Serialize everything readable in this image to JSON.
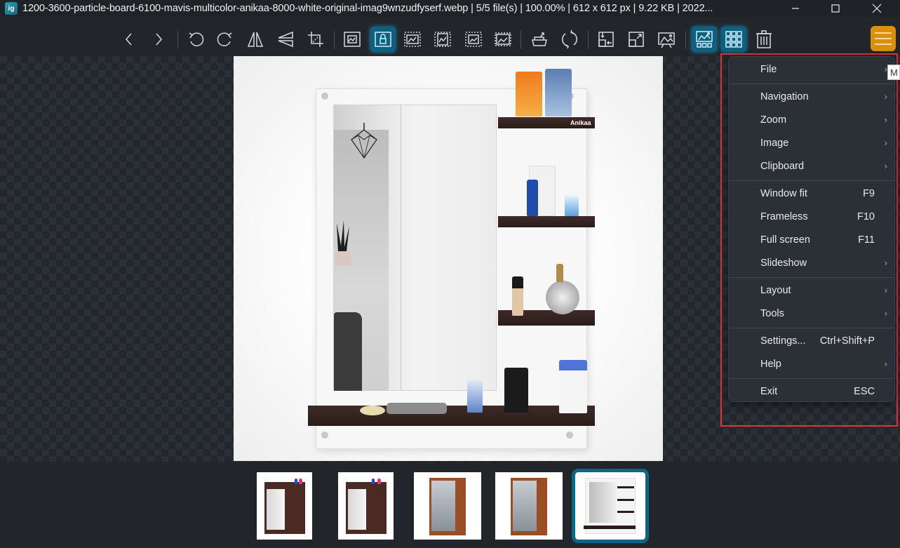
{
  "window": {
    "app_icon": "imageglass-icon",
    "title": "1200-3600-particle-board-6100-mavis-multicolor-anikaa-8000-white-original-imag9wnzudfyserf.webp  |  5/5 file(s)  |  100.00%  |  612 x 612 px  |  9.22 KB  |  2022...",
    "file_name": "1200-3600-particle-board-6100-mavis-multicolor-anikaa-8000-white-original-imag9wnzudfyserf.webp",
    "file_index": "5/5 file(s)",
    "zoom": "100.00%",
    "dimensions": "612 x 612 px",
    "file_size": "9.22 KB",
    "date": "2022...",
    "controls": {
      "minimize": "minimize-icon",
      "maximize": "maximize-icon",
      "close": "close-icon"
    }
  },
  "toolbar": {
    "buttons": [
      {
        "id": "previous",
        "icon": "chevron-left-icon",
        "active": false
      },
      {
        "id": "next",
        "icon": "chevron-right-icon",
        "active": false
      },
      {
        "id": "rotate-left",
        "icon": "rotate-left-icon",
        "active": false
      },
      {
        "id": "rotate-right",
        "icon": "rotate-right-icon",
        "active": false
      },
      {
        "id": "flip-horizontal",
        "icon": "flip-horizontal-icon",
        "active": false
      },
      {
        "id": "flip-vertical",
        "icon": "flip-vertical-icon",
        "active": false
      },
      {
        "id": "crop",
        "icon": "crop-icon",
        "active": false
      },
      {
        "id": "auto-zoom",
        "icon": "auto-zoom-icon",
        "active": false
      },
      {
        "id": "lock-zoom",
        "icon": "lock-zoom-icon",
        "active": true
      },
      {
        "id": "scale-to-width",
        "icon": "scale-to-width-icon",
        "active": false
      },
      {
        "id": "scale-to-height",
        "icon": "scale-to-height-icon",
        "active": false
      },
      {
        "id": "scale-to-fit",
        "icon": "scale-to-fit-icon",
        "active": false
      },
      {
        "id": "scale-to-fill",
        "icon": "scale-to-fill-icon",
        "active": false
      },
      {
        "id": "open-with",
        "icon": "open-with-icon",
        "active": false
      },
      {
        "id": "refresh",
        "icon": "refresh-icon",
        "active": false
      },
      {
        "id": "window-fit",
        "icon": "window-fit-icon",
        "active": false
      },
      {
        "id": "full-screen",
        "icon": "full-screen-icon",
        "active": false
      },
      {
        "id": "slideshow",
        "icon": "slideshow-icon",
        "active": false
      },
      {
        "id": "thumbnail-bar",
        "icon": "thumbnail-bar-icon",
        "active": true
      },
      {
        "id": "checkerboard",
        "icon": "grid-icon",
        "active": true
      },
      {
        "id": "delete",
        "icon": "trash-icon",
        "active": false
      }
    ],
    "main_menu_icon": "hamburger-menu-icon",
    "accent_color": "#0f5f7e",
    "menu_button_color": "#d9900c"
  },
  "main_menu": {
    "items": [
      {
        "label": "File",
        "shortcut": "",
        "submenu": true
      },
      {
        "label": "Navigation",
        "shortcut": "",
        "submenu": true
      },
      {
        "label": "Zoom",
        "shortcut": "",
        "submenu": true
      },
      {
        "label": "Image",
        "shortcut": "",
        "submenu": true
      },
      {
        "label": "Clipboard",
        "shortcut": "",
        "submenu": true
      },
      {
        "label": "Window fit",
        "shortcut": "F9",
        "submenu": false
      },
      {
        "label": "Frameless",
        "shortcut": "F10",
        "submenu": false
      },
      {
        "label": "Full screen",
        "shortcut": "F11",
        "submenu": false
      },
      {
        "label": "Slideshow",
        "shortcut": "",
        "submenu": true
      },
      {
        "label": "Layout",
        "shortcut": "",
        "submenu": true
      },
      {
        "label": "Tools",
        "shortcut": "",
        "submenu": true
      },
      {
        "label": "Settings...",
        "shortcut": "Ctrl+Shift+P",
        "submenu": false
      },
      {
        "label": "Help",
        "shortcut": "",
        "submenu": true
      },
      {
        "label": "Exit",
        "shortcut": "ESC",
        "submenu": false
      }
    ],
    "chevron": "›",
    "tooltip": "M",
    "highlight_color": "#e0343e"
  },
  "viewer": {
    "image_description": "White wall mirror with dark brown shelves holding cosmetics",
    "brand_text": "Anikaa"
  },
  "thumbnails": [
    {
      "name": "thumbnail-1",
      "style": "dark-wood",
      "active": false
    },
    {
      "name": "thumbnail-2",
      "style": "dark-wood",
      "active": false
    },
    {
      "name": "thumbnail-3",
      "style": "brown-wood",
      "active": false
    },
    {
      "name": "thumbnail-4",
      "style": "brown-wood",
      "active": false
    },
    {
      "name": "thumbnail-5",
      "style": "white",
      "active": true
    }
  ]
}
